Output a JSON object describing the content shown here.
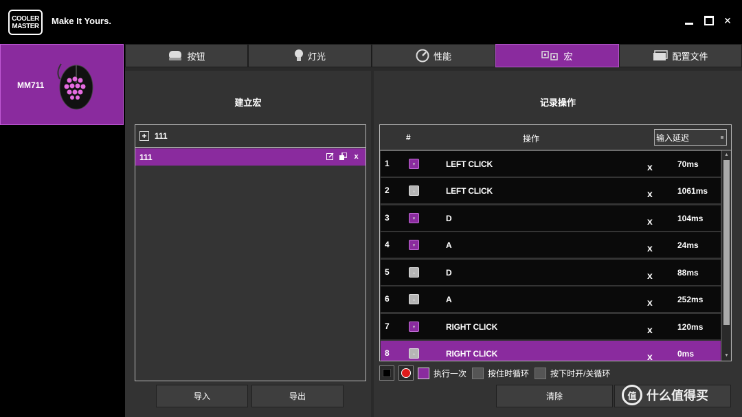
{
  "app": {
    "brand_line1": "COOLER",
    "brand_line2": "MASTER",
    "tagline": "Make It Yours."
  },
  "window": {
    "close_label": "✕"
  },
  "device": {
    "name": "MM711"
  },
  "tabs": [
    {
      "label": "按钮",
      "icon": "mouse-icon",
      "active": false
    },
    {
      "label": "灯光",
      "icon": "light-bulb-icon",
      "active": false
    },
    {
      "label": "性能",
      "icon": "gauge-icon",
      "active": false
    },
    {
      "label": "宏",
      "icon": "macro-icon",
      "active": true
    },
    {
      "label": "配置文件",
      "icon": "profile-icon",
      "active": false
    }
  ],
  "left_panel": {
    "title": "建立宏",
    "new_macro_name": "111",
    "macros": [
      {
        "name": "111",
        "selected": true
      }
    ],
    "import_label": "导入",
    "export_label": "导出"
  },
  "right_panel": {
    "title": "记录操作",
    "col_index": "#",
    "col_action": "操作",
    "delay_select_value": "输入延迟",
    "delete_glyph": "x",
    "records": [
      {
        "idx": "1",
        "key_state": "down",
        "action": "LEFT CLICK",
        "delay": "70ms",
        "selected": false
      },
      {
        "idx": "2",
        "key_state": "up",
        "action": "LEFT CLICK",
        "delay": "1061ms",
        "selected": false
      },
      {
        "idx": "3",
        "key_state": "down",
        "action": "D",
        "delay": "104ms",
        "selected": false
      },
      {
        "idx": "4",
        "key_state": "down",
        "action": "A",
        "delay": "24ms",
        "selected": false
      },
      {
        "idx": "5",
        "key_state": "up",
        "action": "D",
        "delay": "88ms",
        "selected": false
      },
      {
        "idx": "6",
        "key_state": "up",
        "action": "A",
        "delay": "252ms",
        "selected": false
      },
      {
        "idx": "7",
        "key_state": "down",
        "action": "RIGHT CLICK",
        "delay": "120ms",
        "selected": false
      },
      {
        "idx": "8",
        "key_state": "up",
        "action": "RIGHT CLICK",
        "delay": "0ms",
        "selected": true
      }
    ],
    "options": {
      "run_once": "执行一次",
      "loop_while_held": "按住时循环",
      "toggle_loop": "按下时开/关循环"
    },
    "clear_label": "清除"
  },
  "watermark": {
    "badge": "值",
    "text": "什么值得买"
  },
  "colors": {
    "accent": "#8a2b9e",
    "panel": "#333333",
    "background": "#000000"
  }
}
